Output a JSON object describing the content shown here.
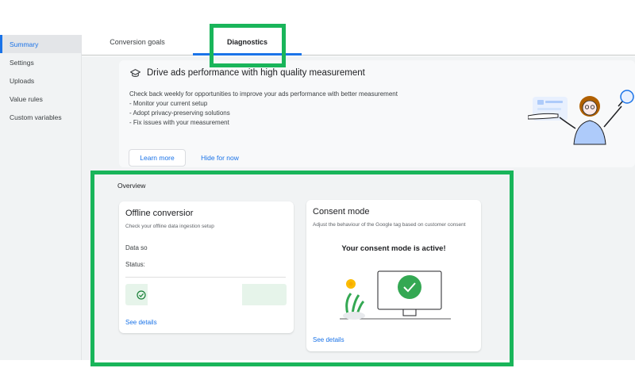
{
  "sidebar": {
    "items": [
      {
        "label": "Summary",
        "active": true
      },
      {
        "label": "Settings"
      },
      {
        "label": "Uploads"
      },
      {
        "label": "Value rules"
      },
      {
        "label": "Custom variables"
      }
    ]
  },
  "tabs": [
    {
      "label": "Conversion goals"
    },
    {
      "label": "Diagnostics",
      "selected": true
    }
  ],
  "banner": {
    "icon": "graduation-cap-icon",
    "title": "Drive ads performance with high quality measurement",
    "lines": [
      "Check back weekly for opportunities to improve your ads performance with better measurement",
      "- Monitor your current setup",
      "- Adopt privacy-preserving solutions",
      "- Fix issues with your measurement"
    ],
    "learn_more": "Learn more",
    "hide": "Hide for now"
  },
  "overview": {
    "title": "Overview",
    "offline": {
      "title": "Offline conversior",
      "subtitle": "Check your offline data ingestion setup",
      "data_label": "Data so",
      "status_label": "Status:",
      "see_details": "See details"
    },
    "consent": {
      "title": "Consent mode",
      "subtitle": "Adjust the behaviour of the Google tag based on customer consent",
      "active_text": "Your consent mode is active!",
      "see_details": "See details"
    }
  },
  "colors": {
    "accent": "#1a73e8",
    "highlight": "#19b55a",
    "success_green": "#34a853"
  }
}
